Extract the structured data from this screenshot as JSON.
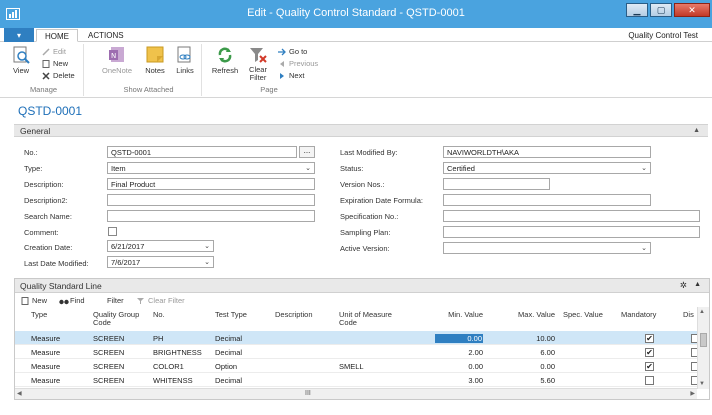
{
  "window": {
    "title": "Edit - Quality Control Standard - QSTD-0001"
  },
  "ribbon": {
    "tabs": [
      {
        "label": "HOME"
      },
      {
        "label": "ACTIONS"
      }
    ],
    "company": "Quality Control Test",
    "groups": {
      "manage": {
        "label": "Manage",
        "view": "View",
        "edit": "Edit",
        "new": "New",
        "delete": "Delete"
      },
      "show_attached": {
        "label": "Show Attached",
        "onenote": "OneNote",
        "notes": "Notes",
        "links": "Links"
      },
      "page": {
        "label": "Page",
        "refresh": "Refresh",
        "clear_filter": "Clear Filter",
        "go_to": "Go to",
        "previous": "Previous",
        "next": "Next"
      }
    }
  },
  "page": {
    "title": "QSTD-0001"
  },
  "general": {
    "header": "General",
    "no": {
      "label": "No.:",
      "value": "QSTD-0001",
      "assist": "..."
    },
    "type": {
      "label": "Type:",
      "value": "Item"
    },
    "description": {
      "label": "Description:",
      "value": "Final Product"
    },
    "description2": {
      "label": "Description2:",
      "value": ""
    },
    "search_name": {
      "label": "Search Name:",
      "value": ""
    },
    "comment": {
      "label": "Comment:",
      "checked": false
    },
    "creation_date": {
      "label": "Creation Date:",
      "value": "6/21/2017"
    },
    "last_date_modified": {
      "label": "Last Date Modified:",
      "value": "7/6/2017"
    },
    "last_modified_by": {
      "label": "Last Modified By:",
      "value": "NAVIWORLDTH\\AKA"
    },
    "status": {
      "label": "Status:",
      "value": "Certified"
    },
    "version_nos": {
      "label": "Version Nos.:",
      "value": ""
    },
    "expiration_date_formula": {
      "label": "Expiration Date Formula:",
      "value": ""
    },
    "specification_no": {
      "label": "Specification No.:",
      "value": ""
    },
    "sampling_plan": {
      "label": "Sampling Plan:",
      "value": ""
    },
    "active_version": {
      "label": "Active Version:",
      "value": ""
    }
  },
  "lines": {
    "header": "Quality Standard Line",
    "tools": {
      "new": "New",
      "find": "Find",
      "filter": "Filter",
      "clear_filter": "Clear Filter"
    },
    "columns": {
      "type": "Type",
      "quality_group_code": "Quality Group Code",
      "no": "No.",
      "test_type": "Test Type",
      "description": "Description",
      "uom_code": "Unit of Measure Code",
      "min_value": "Min. Value",
      "max_value": "Max. Value",
      "spec_value": "Spec. Value",
      "mandatory": "Mandatory",
      "dis": "Dis"
    },
    "rows": [
      {
        "type": "Measure",
        "group": "SCREEN",
        "no": "PH",
        "test_type": "Decimal",
        "uom": "",
        "min": "0.00",
        "max": "10.00",
        "mandatory": true
      },
      {
        "type": "Measure",
        "group": "SCREEN",
        "no": "BRIGHTNESS",
        "test_type": "Decimal",
        "uom": "",
        "min": "2.00",
        "max": "6.00",
        "mandatory": true
      },
      {
        "type": "Measure",
        "group": "SCREEN",
        "no": "COLOR1",
        "test_type": "Option",
        "uom": "SMELL",
        "min": "0.00",
        "max": "0.00",
        "mandatory": true
      },
      {
        "type": "Measure",
        "group": "SCREEN",
        "no": "WHITENSS",
        "test_type": "Decimal",
        "uom": "",
        "min": "3.00",
        "max": "5.60",
        "mandatory": false
      }
    ],
    "hscroll_label": "III"
  }
}
